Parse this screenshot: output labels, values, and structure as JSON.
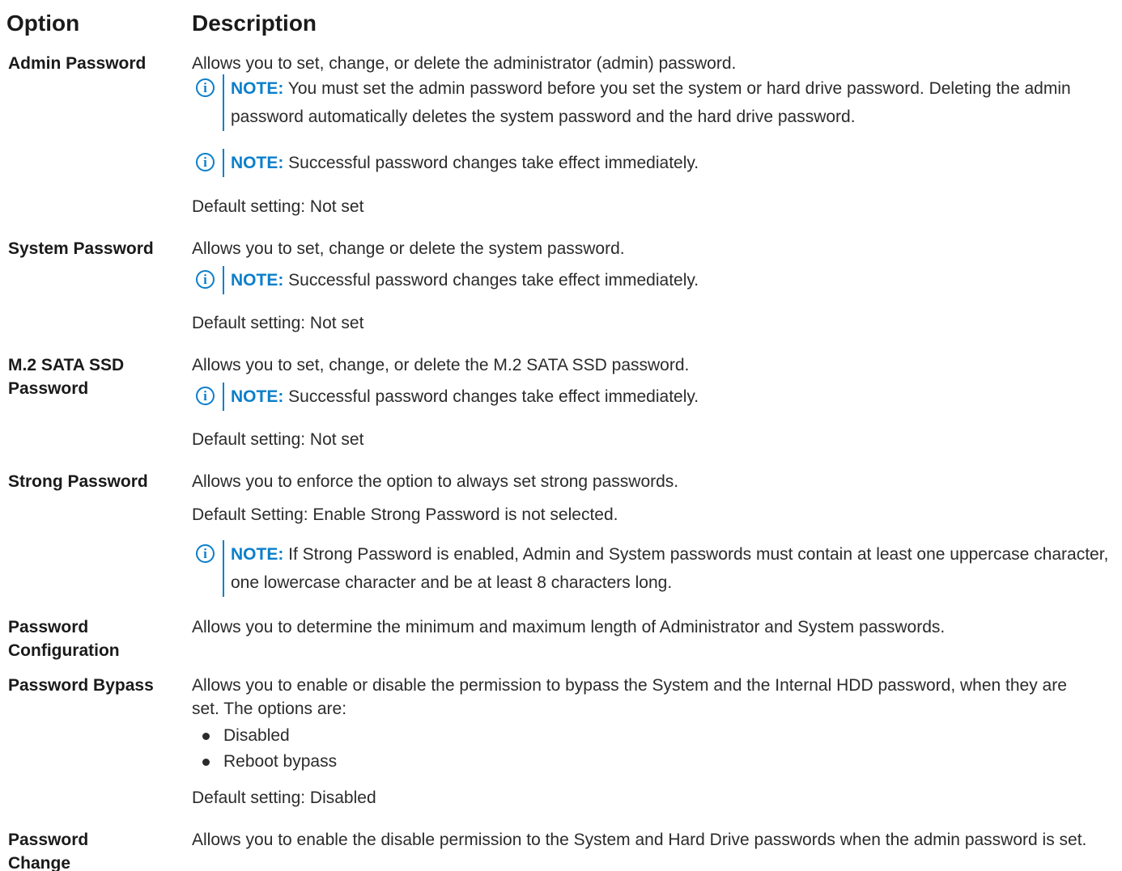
{
  "header": {
    "option": "Option",
    "description": "Description"
  },
  "note_keyword": "NOTE:",
  "rows": [
    {
      "label": "Admin Password",
      "text": "Allows you to set, change, or delete the administrator (admin) password.",
      "notes": [
        "You must set the admin password before you set the system or hard drive password. Deleting the admin password automatically deletes the system password and the hard drive password.",
        "Successful password changes take effect immediately."
      ],
      "default": "Default setting: Not set"
    },
    {
      "label": "System Password",
      "text": "Allows you to set, change or delete the system password.",
      "notes": [
        "Successful password changes take effect immediately."
      ],
      "default": "Default setting: Not set"
    },
    {
      "label": "M.2 SATA SSD Password",
      "text": "Allows you to set, change, or delete the M.2 SATA SSD password.",
      "notes": [
        "Successful password changes take effect immediately."
      ],
      "default": "Default setting: Not set"
    },
    {
      "label": "Strong Password",
      "text": "Allows you to enforce the option to always set strong passwords.",
      "default": "Default Setting: Enable Strong Password is not selected.",
      "notes": [
        "If Strong Password is enabled, Admin and System passwords must contain at least one uppercase character, one lowercase character and be at least 8 characters long."
      ]
    },
    {
      "label": "Password Configuration",
      "text": "Allows you to determine the minimum and maximum length of Administrator and System passwords."
    },
    {
      "label": "Password Bypass",
      "text": "Allows you to enable or disable the permission to bypass the System and the Internal HDD password, when they are set. The options are:",
      "options": [
        "Disabled",
        "Reboot bypass"
      ],
      "default": "Default setting: Disabled"
    },
    {
      "label": "Password Change",
      "text": "Allows you to enable the disable permission to the System and Hard Drive passwords when the admin password is set."
    }
  ]
}
